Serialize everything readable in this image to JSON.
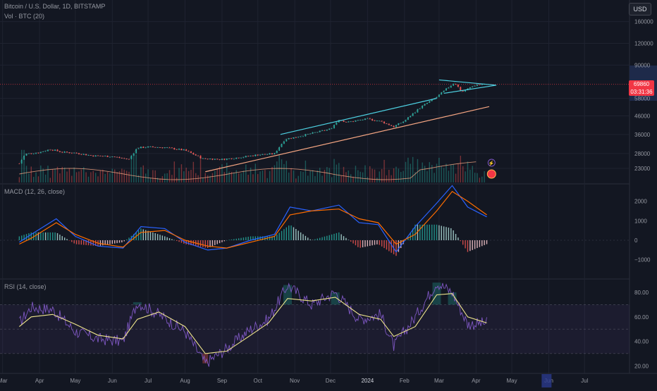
{
  "header": {
    "symbol_line": "Bitcoin / U.S. Dollar, 1D, BITSTAMP",
    "volume_line": "Vol · BTC (20)",
    "currency_button": "USD"
  },
  "price_tag": {
    "price": "69860",
    "countdown": "03:31:36"
  },
  "panes": {
    "macd_label": "MACD (12, 26, close)",
    "rsi_label": "RSI (14, close)"
  },
  "colors": {
    "background": "#131722",
    "candle_up": "#26a69a",
    "candle_down": "#ef5350",
    "trend_cyan": "#4dd0e1",
    "trend_orange": "#f4a582",
    "macd_line": "#2962ff",
    "signal_line": "#ff6d00",
    "rsi_line": "#7e57c2",
    "rsi_ma": "#f0e68c"
  },
  "chart_data": [
    {
      "type": "candlestick",
      "title": "Bitcoin / U.S. Dollar, 1D, BITSTAMP",
      "y_scale": "log",
      "y_ticks": [
        23000,
        28000,
        36000,
        46000,
        58000,
        69860,
        90000,
        120000,
        160000
      ],
      "y_tick_labels": [
        "23000",
        "28000",
        "36000",
        "46000",
        "58000",
        "",
        "90000",
        "120000",
        "160000"
      ],
      "x_tick_labels": [
        "Mar",
        "Apr",
        "May",
        "Jun",
        "Jul",
        "Aug",
        "Sep",
        "Oct",
        "Nov",
        "Dec",
        "2024",
        "Feb",
        "Mar",
        "Apr",
        "May",
        "Jun",
        "Jul"
      ],
      "x": [
        "2023-03-15",
        "2023-03-20",
        "2023-04-01",
        "2023-04-10",
        "2023-04-20",
        "2023-05-01",
        "2023-05-15",
        "2023-06-01",
        "2023-06-15",
        "2023-06-22",
        "2023-07-01",
        "2023-07-15",
        "2023-08-01",
        "2023-08-16",
        "2023-08-20",
        "2023-09-01",
        "2023-09-15",
        "2023-10-01",
        "2023-10-15",
        "2023-10-24",
        "2023-11-01",
        "2023-11-15",
        "2023-12-01",
        "2023-12-08",
        "2023-12-15",
        "2024-01-01",
        "2024-01-12",
        "2024-01-23",
        "2024-02-01",
        "2024-02-15",
        "2024-02-28",
        "2024-03-05",
        "2024-03-14",
        "2024-03-20",
        "2024-04-01",
        "2024-04-09"
      ],
      "close": [
        24500,
        27800,
        28400,
        29600,
        28500,
        28200,
        27200,
        26900,
        25900,
        30200,
        30500,
        30300,
        29200,
        26100,
        26100,
        25900,
        26500,
        27500,
        27900,
        33900,
        34600,
        36500,
        38700,
        43800,
        42300,
        44200,
        42800,
        39900,
        43000,
        51800,
        59000,
        63800,
        71500,
        63000,
        69500,
        69860
      ],
      "trendlines": [
        {
          "color": "cyan",
          "from": [
            "2023-10-20",
            36000
          ],
          "to": [
            "2024-02-28",
            58000
          ]
        },
        {
          "color": "cyan",
          "from": [
            "2024-03-01",
            74000
          ],
          "to": [
            "2024-04-18",
            69000
          ]
        },
        {
          "color": "cyan",
          "from": [
            "2024-03-05",
            62000
          ],
          "to": [
            "2024-04-18",
            69000
          ]
        },
        {
          "color": "orange",
          "from": [
            "2023-08-18",
            22000
          ],
          "to": [
            "2024-04-12",
            52000
          ]
        }
      ],
      "volume_ma_series": "Vol · BTC (20)"
    },
    {
      "type": "line",
      "title": "MACD (12, 26, close)",
      "y_ticks": [
        -1000,
        0,
        1000,
        2000
      ],
      "y_tick_labels": [
        "−1000",
        "0",
        "1000",
        "2000"
      ],
      "x": [
        "2023-03-15",
        "2023-03-25",
        "2023-04-15",
        "2023-05-01",
        "2023-05-20",
        "2023-06-10",
        "2023-06-25",
        "2023-07-15",
        "2023-08-01",
        "2023-08-20",
        "2023-09-05",
        "2023-09-25",
        "2023-10-15",
        "2023-10-28",
        "2023-11-15",
        "2023-12-08",
        "2023-12-25",
        "2024-01-10",
        "2024-01-25",
        "2024-02-10",
        "2024-02-28",
        "2024-03-12",
        "2024-03-25",
        "2024-04-10"
      ],
      "macd": [
        -100,
        300,
        1100,
        200,
        -300,
        -400,
        700,
        600,
        -100,
        -500,
        -400,
        0,
        300,
        1700,
        1500,
        1800,
        900,
        800,
        -600,
        700,
        1900,
        2800,
        1700,
        1200
      ],
      "signal": [
        -200,
        100,
        900,
        300,
        -150,
        -350,
        400,
        500,
        0,
        -300,
        -400,
        -100,
        200,
        1300,
        1500,
        1600,
        1100,
        900,
        -200,
        300,
        1500,
        2500,
        2000,
        1300
      ]
    },
    {
      "type": "line",
      "title": "RSI (14, close)",
      "y_ticks": [
        20,
        40,
        60,
        80
      ],
      "y_tick_labels": [
        "20.00",
        "40.00",
        "60.00",
        "80.00"
      ],
      "bands": [
        30,
        50,
        70
      ],
      "x": [
        "2023-03-15",
        "2023-03-25",
        "2023-04-12",
        "2023-05-01",
        "2023-05-20",
        "2023-06-10",
        "2023-06-22",
        "2023-07-10",
        "2023-08-01",
        "2023-08-18",
        "2023-09-05",
        "2023-09-25",
        "2023-10-10",
        "2023-10-26",
        "2023-11-15",
        "2023-12-05",
        "2023-12-25",
        "2024-01-12",
        "2024-01-23",
        "2024-02-10",
        "2024-02-28",
        "2024-03-12",
        "2024-03-25",
        "2024-04-10"
      ],
      "rsi": [
        55,
        68,
        66,
        48,
        42,
        40,
        72,
        62,
        48,
        22,
        34,
        50,
        58,
        86,
        70,
        80,
        58,
        62,
        36,
        60,
        88,
        80,
        54,
        55
      ],
      "rsi_ma": [
        52,
        60,
        62,
        54,
        45,
        42,
        58,
        64,
        52,
        30,
        32,
        45,
        55,
        75,
        73,
        76,
        62,
        58,
        44,
        52,
        78,
        79,
        60,
        55
      ]
    }
  ]
}
